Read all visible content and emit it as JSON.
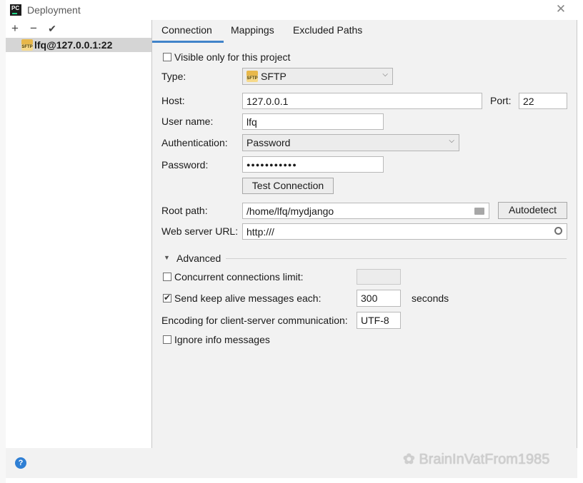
{
  "window": {
    "title": "Deployment",
    "app_icon_text": "PC"
  },
  "left_panel": {
    "toolbar": {
      "add": "+",
      "remove": "−",
      "check": "✔"
    },
    "servers": [
      {
        "name": "lfq@127.0.0.1:22",
        "icon": "sftp-icon",
        "icon_text": "SFTP"
      }
    ]
  },
  "tabs": [
    {
      "label": "Connection",
      "active": true
    },
    {
      "label": "Mappings"
    },
    {
      "label": "Excluded Paths"
    }
  ],
  "connection": {
    "visible_only_label": "Visible only for this project",
    "visible_only_checked": false,
    "type_label": "Type:",
    "type_value": "SFTP",
    "type_icon_text": "SFTP",
    "host_label": "Host:",
    "host_value": "127.0.0.1",
    "port_label": "Port:",
    "port_value": "22",
    "username_label": "User name:",
    "username_value": "lfq",
    "auth_label": "Authentication:",
    "auth_value": "Password",
    "password_label": "Password:",
    "password_value": "●●●●●●●●●●●",
    "test_connection": "Test Connection",
    "root_path_label": "Root path:",
    "root_path_value": "/home/lfq/mydjango",
    "autodetect": "Autodetect",
    "web_url_label": "Web server URL:",
    "web_url_value": "http:///"
  },
  "advanced": {
    "section_label": "Advanced",
    "concurrent_label": "Concurrent connections limit:",
    "concurrent_checked": false,
    "concurrent_value": "",
    "keepalive_label": "Send keep alive messages each:",
    "keepalive_checked": true,
    "keepalive_value": "300",
    "keepalive_unit": "seconds",
    "encoding_label": "Encoding for client-server communication:",
    "encoding_value": "UTF-8",
    "ignore_info_label": "Ignore info messages",
    "ignore_info_checked": false
  },
  "footer": {
    "help": "?",
    "watermark": "BrainInVatFrom1985"
  }
}
